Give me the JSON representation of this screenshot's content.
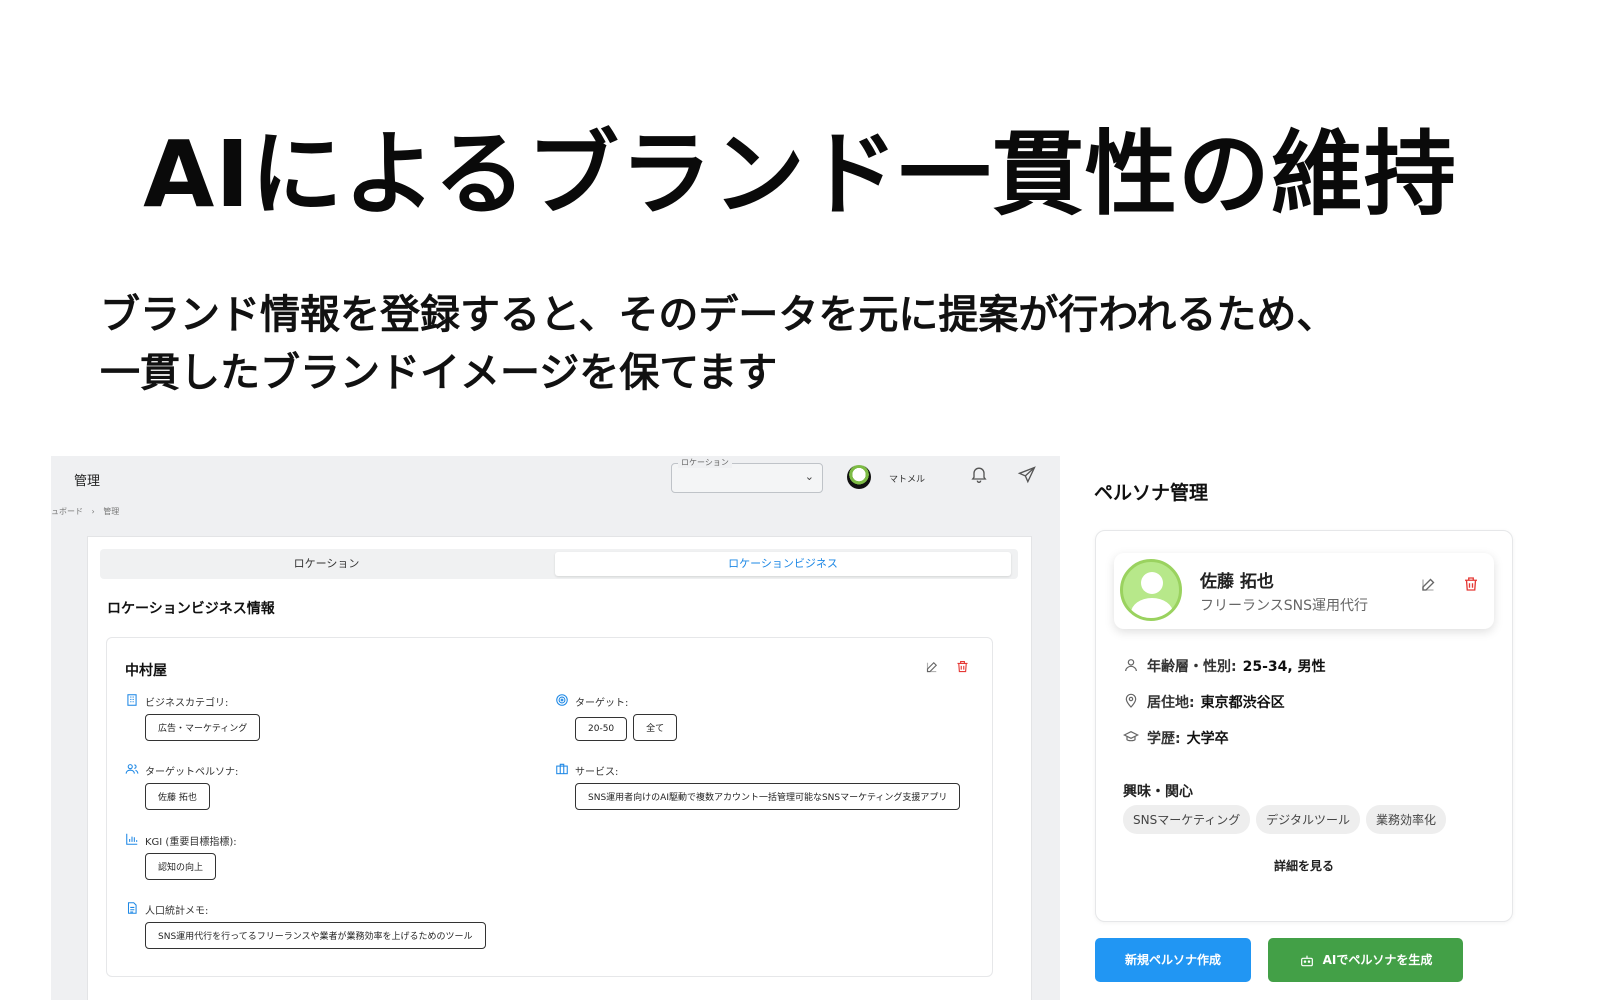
{
  "headline": "AIによるブランド一貫性の維持",
  "subtitle": {
    "line1": "ブランド情報を登録すると、そのデータを元に提案が行われるため、",
    "line2": "一貫したブランドイメージを保てます"
  },
  "app": {
    "title": "管理",
    "location_select": {
      "legend": "ロケーション",
      "value": ""
    },
    "user_name": "マトメル",
    "breadcrumb": [
      "ュボード",
      "›",
      "管理"
    ],
    "tabs": [
      {
        "label": "ロケーション"
      },
      {
        "label": "ロケーションビジネス"
      }
    ],
    "section_title": "ロケーションビジネス情報",
    "business": {
      "name": "中村屋",
      "fields": {
        "category": {
          "label": "ビジネスカテゴリ:",
          "values": [
            "広告・マーケティング"
          ]
        },
        "target": {
          "label": "ターゲット:",
          "values": [
            "20-50",
            "全て"
          ]
        },
        "persona": {
          "label": "ターゲットペルソナ:",
          "values": [
            "佐藤 拓也"
          ]
        },
        "service": {
          "label": "サービス:",
          "values": [
            "SNS運用者向けのAI駆動で複数アカウント一括管理可能なSNSマーケティング支援アプリ"
          ]
        },
        "kgi": {
          "label": "KGI (重要目標指標):",
          "values": [
            "認知の向上"
          ]
        },
        "memo": {
          "label": "人口統計メモ:",
          "values": [
            "SNS運用代行を行ってるフリーランスや業者が業務効率を上げるためのツール"
          ]
        }
      }
    }
  },
  "persona": {
    "section_title": "ペルソナ管理",
    "name": "佐藤 拓也",
    "role": "フリーランスSNS運用代行",
    "age_gender": {
      "label": "年齢層・性別:",
      "value": "25-34, 男性"
    },
    "residence": {
      "label": "居住地:",
      "value": "東京都渋谷区"
    },
    "education": {
      "label": "学歴:",
      "value": "大学卒"
    },
    "interests_title": "興味・関心",
    "interests": [
      "SNSマーケティング",
      "デジタルツール",
      "業務効率化"
    ],
    "detail_link": "詳細を見る",
    "new_button": "新規ペルソナ作成",
    "ai_button": "AIでペルソナを生成"
  },
  "colors": {
    "accent_blue": "#2196f3",
    "tab_blue": "#1e88e5",
    "ai_green": "#43a047",
    "delete_red": "#e53935"
  }
}
